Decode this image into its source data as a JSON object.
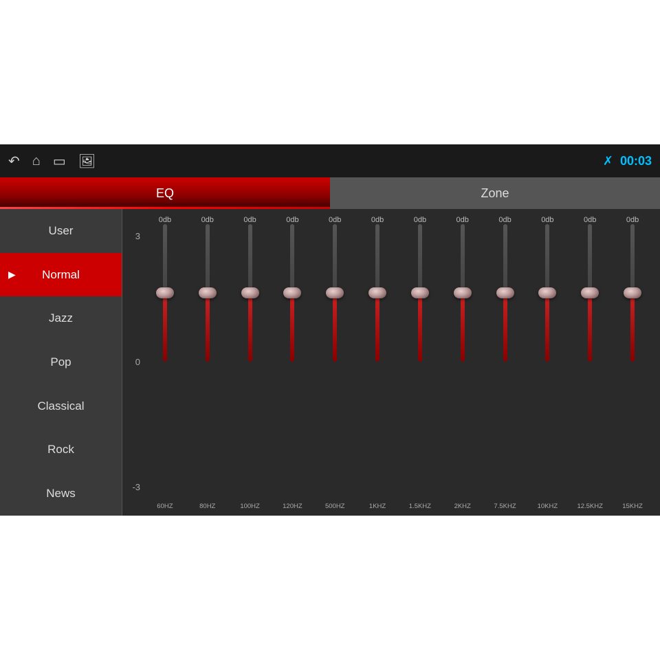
{
  "topbar": {
    "time": "00:03",
    "bluetooth_label": "BT",
    "nav": {
      "back": "←",
      "home": "⌂",
      "window": "▭",
      "image": "🖼"
    }
  },
  "tabs": [
    {
      "id": "eq",
      "label": "EQ",
      "active": true
    },
    {
      "id": "zone",
      "label": "Zone",
      "active": false
    }
  ],
  "sidebar": {
    "items": [
      {
        "id": "user",
        "label": "User",
        "active": false
      },
      {
        "id": "normal",
        "label": "Normal",
        "active": true
      },
      {
        "id": "jazz",
        "label": "Jazz",
        "active": false
      },
      {
        "id": "pop",
        "label": "Pop",
        "active": false
      },
      {
        "id": "classical",
        "label": "Classical",
        "active": false
      },
      {
        "id": "rock",
        "label": "Rock",
        "active": false
      },
      {
        "id": "news",
        "label": "News",
        "active": false
      }
    ]
  },
  "eq": {
    "labels": {
      "top": "3",
      "mid": "0",
      "bot": "-3"
    },
    "bands": [
      {
        "freq": "60HZ",
        "db": "0db",
        "value": 0
      },
      {
        "freq": "80HZ",
        "db": "0db",
        "value": 0
      },
      {
        "freq": "100HZ",
        "db": "0db",
        "value": 0
      },
      {
        "freq": "120HZ",
        "db": "0db",
        "value": 0
      },
      {
        "freq": "500HZ",
        "db": "0db",
        "value": 0
      },
      {
        "freq": "1KHZ",
        "db": "0db",
        "value": 0
      },
      {
        "freq": "1.5KHZ",
        "db": "0db",
        "value": 0
      },
      {
        "freq": "2KHZ",
        "db": "0db",
        "value": 0
      },
      {
        "freq": "7.5KHZ",
        "db": "0db",
        "value": 0
      },
      {
        "freq": "10KHZ",
        "db": "0db",
        "value": 0
      },
      {
        "freq": "12.5KHZ",
        "db": "0db",
        "value": 0
      },
      {
        "freq": "15KHZ",
        "db": "0db",
        "value": 0
      }
    ]
  }
}
